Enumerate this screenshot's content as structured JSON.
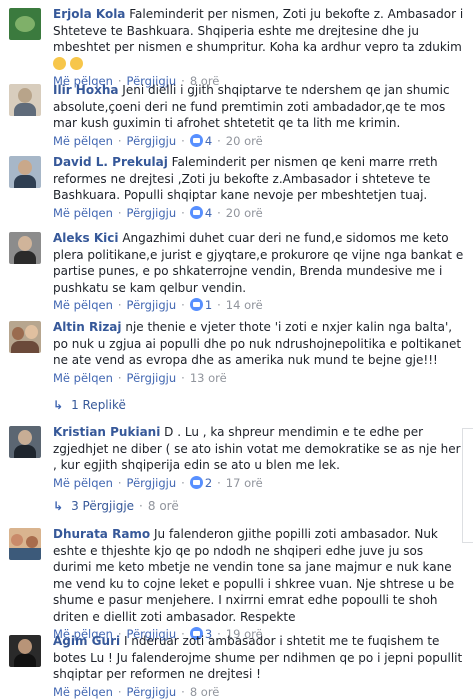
{
  "actions": {
    "like": "Më pëlqen",
    "reply": "Përgjigju",
    "sep": "·"
  },
  "comments": [
    {
      "author": "Erjola Kola",
      "text": "Faleminderit per nismen, Zoti ju bekofte z. Ambasador i Shteteve te Bashkuara. Shqiperia eshte me drejtesine dhe ju mbeshtet per nismen e shumpritur. Koha ka ardhur vepro ta zdukim",
      "likes": "",
      "time": "8 orë",
      "avatar_color": "#3b7a3e"
    },
    {
      "author": "Ilir Hoxha",
      "text": "Jeni dielli i gjith shqiptarve te ndershem qe jan shumic absolute,çoeni deri ne fund premtimin zoti ambadador,qe te mos mar kush guximin ti afrohet shtetetit qe ta lith me krimin.",
      "likes": "4",
      "time": "20 orë",
      "avatar_color": "#b8a48a"
    },
    {
      "author": "David L. Prekulaj",
      "text": "Faleminderit per nismen qe keni marre rreth reformes ne drejtesi ,Zoti ju bekofte z.Ambasador i shteteve te Bashkuara. Populli shqiptar kane nevoje per mbeshtetjen tuaj.",
      "likes": "4",
      "time": "20 orë",
      "avatar_color": "#7a8fa6"
    },
    {
      "author": "Aleks Kici",
      "text": "Angazhimi duhet cuar deri ne fund,e sidomos me keto plera politikane,e jurist e gjyqtare,e prokurore qe vijne nga bankat e partise punes, e po shkaterrojne vendin, Brenda mundesive me i pushkatu se kam qelbur vendin.",
      "likes": "1",
      "time": "14 orë",
      "avatar_color": "#6b6b6b"
    },
    {
      "author": "Altin Rizaj",
      "text": "nje thenie e vjeter thote 'i zoti e nxjer kalin nga balta', po nuk u zgjua ai populli dhe po nuk ndrushojnepolitika e poltikanet ne ate vend as evropa dhe as amerika nuk mund te bejne gje!!!",
      "likes": "",
      "time": "13 orë",
      "avatar_color": "#9a6b4f",
      "replies": "1 Replikë"
    },
    {
      "author": "Kristian Pukiani",
      "text": "D . Lu , ka shpreur mendimin e te edhe per zgjedhjet ne diber ( se ato ishin votat me demokratike se as nje her , kur egjith shqiperija edin se ato u blen me lek.",
      "likes": "2",
      "time": "17 orë",
      "avatar_color": "#4a4f57",
      "replies": "3 Përgjigje",
      "replies_time": "8 orë"
    },
    {
      "author": "Dhurata Ramo",
      "text": "Ju falenderon gjithe popilli zoti ambasador. Nuk eshte e thjeshte kjo qe po ndodh ne shqiperi edhe juve ju sos durimi me keto mbetje ne vendin tone sa jane majmur e nuk kane me vend ku to cojne leket e populli i shkree vuan. Nje shtrese u be shume e pasur menjehere. I nxirrni emrat edhe popoulli te shoh driten e diellit zoti ambasador. Respekte",
      "likes": "3",
      "time": "19 orë",
      "avatar_color": "#c98a6a"
    },
    {
      "author": "Agim Guri",
      "text": "I nderuar zoti ambasador i shtetit me te fuqishem te botes Lu ! Ju falenderojme shume per ndihmen qe po i jepni popullit shqiptar per reformen ne drejtesi !",
      "likes": "",
      "time": "8 orë",
      "avatar_color": "#3c3c3c"
    }
  ]
}
